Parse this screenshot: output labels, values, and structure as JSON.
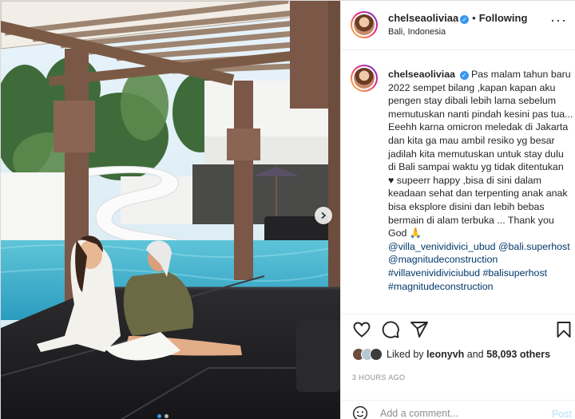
{
  "post": {
    "username": "chelseaoliviaa",
    "verified": true,
    "separator": "•",
    "follow_label": "Following",
    "location": "Bali, Indonesia",
    "more_icon": "more-horizontal-icon"
  },
  "caption": {
    "username": "chelseaoliviaa",
    "line1": "Pas malam tahun baru 2022 sempet bilang ,kapan kapan aku pengen stay dibali lebih lama sebelum memutuskan nanti pindah kesini pas tua...",
    "line2": "Eeehh karna omicron meledak di Jakarta dan kita ga mau ambil resiko yg besar jadilah kita memutuskan untuk stay dulu di Bali sampai waktu yg tidak ditentukan",
    "line3": "♥ supeerr happy ,bisa di sini dalam keadaan sehat dan terpenting anak anak bisa eksplore disini dan lebih bebas bermain di alam terbuka ... Thank you God 🙏",
    "tags": [
      "@villa_venividivici_ubud",
      "@bali.superhost",
      "@magnitudeconstruction",
      "#villavenividiviciubud",
      "#balisuperhost",
      "#magnitudeconstruction"
    ]
  },
  "actions": {
    "icons": [
      "heart-icon",
      "comment-icon",
      "share-icon",
      "bookmark-icon"
    ]
  },
  "likes": {
    "prefix": "Liked by",
    "user": "leonyvh",
    "and": "and",
    "count": "58,093 others"
  },
  "timestamp": "3 HOURS AGO",
  "comment": {
    "placeholder": "Add a comment...",
    "post_label": "Post"
  },
  "carousel": {
    "slides": 2,
    "active_index": 0
  },
  "colors": {
    "link": "#00376b",
    "verified": "#3897f0",
    "post_disabled": "#b2dffc",
    "muted": "#8e8e8e"
  }
}
